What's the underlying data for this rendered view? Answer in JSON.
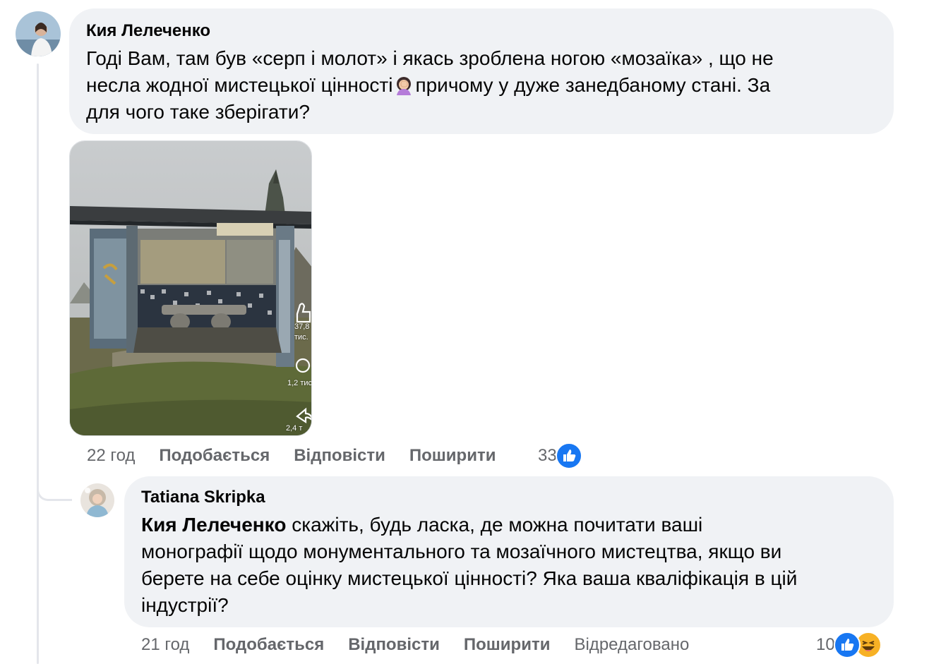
{
  "colors": {
    "bubble_bg": "#f0f2f5",
    "meta_text": "#65676b",
    "like_blue": "#1877f2",
    "haha_yellow": "#f7b125",
    "thread_line": "#e4e6eb"
  },
  "comment1": {
    "author": "Кия Лелеченко",
    "line1": "Годі Вам, там був «серп і молот» і якась зроблена ногою «мозаїка» , що не",
    "line2a": "несла жодної мистецької цінності",
    "emoji": "face-palm-woman-emoji",
    "line2b": "причому у дуже занедбаному стані. За",
    "line3": "для чого таке зберігати?",
    "media": {
      "likes": "37,8",
      "likes_unit": "тис.",
      "comments": "1,2 тис",
      "shares": "2,4 т"
    },
    "time": "22 год",
    "like_label": "Подобається",
    "reply_label": "Відповісти",
    "share_label": "Поширити",
    "reaction_count": "33"
  },
  "comment2": {
    "author": "Tatiana Skripka",
    "mention": "Кия Лелеченко",
    "line1": " скажіть, будь ласка, де можна почитати ваші",
    "line2": "монографії щодо монументального та мозаїчного мистецтва, якщо ви",
    "line3": "берете на себе оцінку мистецької цінності? Яка ваша кваліфікація в цій",
    "line4": "індустрії?",
    "time": "21 год",
    "like_label": "Подобається",
    "reply_label": "Відповісти",
    "share_label": "Поширити",
    "edited_label": "Відредаговано",
    "reaction_count": "10"
  }
}
